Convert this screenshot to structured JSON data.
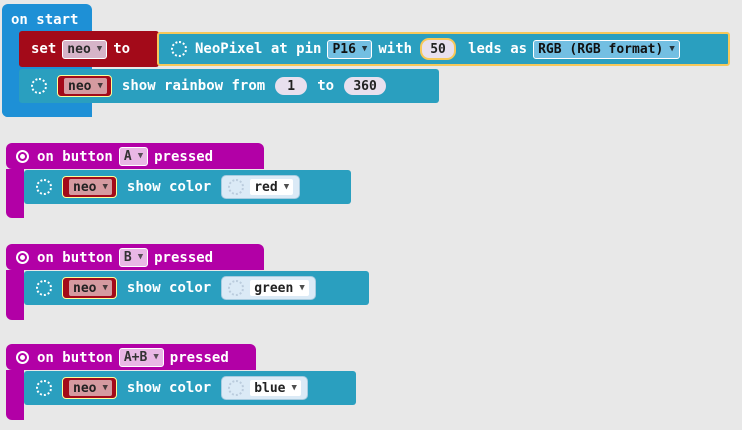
{
  "on_start": {
    "label": "on start",
    "set_label": "set",
    "set_var": "neo",
    "to_label": "to",
    "neopixel_label": "NeoPixel at pin",
    "pin": "P16",
    "with_label": "with",
    "leds_count": "50",
    "leds_as_label": "leds as",
    "format": "RGB (RGB format)",
    "rainbow_var": "neo",
    "rainbow_label": "show rainbow from",
    "from_value": "1",
    "to_word": "to",
    "to_value": "360"
  },
  "buttons": [
    {
      "prefix": "on button",
      "button": "A",
      "suffix": "pressed",
      "var": "neo",
      "action": "show color",
      "color": "red"
    },
    {
      "prefix": "on button",
      "button": "B",
      "suffix": "pressed",
      "var": "neo",
      "action": "show color",
      "color": "green"
    },
    {
      "prefix": "on button",
      "button": "A+B",
      "suffix": "pressed",
      "var": "neo",
      "action": "show color",
      "color": "blue"
    }
  ],
  "colors": {
    "event_blue": "#1e90d6",
    "event_purple": "#b200a6",
    "variable_red": "#a30a19",
    "neopixel_teal": "#2a9fbf"
  }
}
